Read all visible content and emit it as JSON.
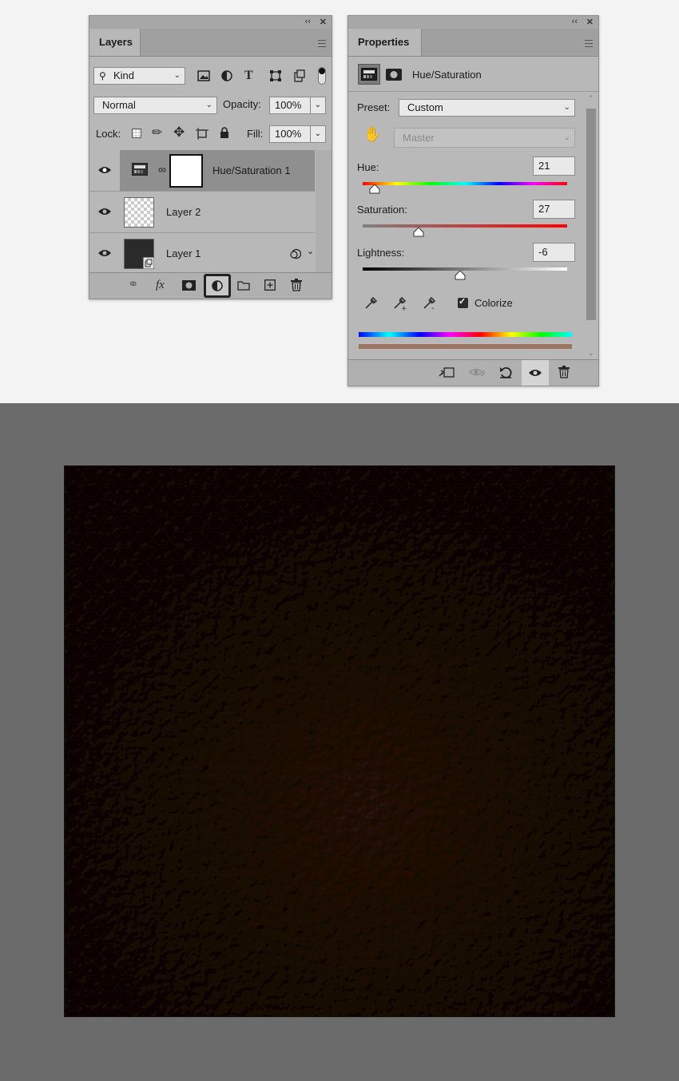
{
  "layers_panel": {
    "tab": "Layers",
    "filter_kind": "Kind",
    "blend_mode": "Normal",
    "opacity_label": "Opacity:",
    "opacity_value": "100%",
    "lock_label": "Lock:",
    "fill_label": "Fill:",
    "fill_value": "100%",
    "layers": [
      {
        "name": "Hue/Saturation 1",
        "type": "adjustment",
        "selected": true
      },
      {
        "name": "Layer 2",
        "type": "transparent"
      },
      {
        "name": "Layer 1",
        "type": "smart-object"
      }
    ],
    "icons": {
      "filter": [
        "image-filter-icon",
        "adjustment-filter-icon",
        "type-filter-icon",
        "shape-filter-icon",
        "smart-object-filter-icon",
        "filter-toggle-icon"
      ],
      "lock": [
        "lock-transparent-icon",
        "lock-pixels-icon",
        "lock-position-icon",
        "lock-artboard-icon",
        "lock-all-icon"
      ],
      "bottom": [
        "link-icon",
        "fx-icon",
        "mask-icon",
        "adjustment-layer-icon",
        "folder-icon",
        "new-layer-icon",
        "trash-icon"
      ]
    }
  },
  "properties_panel": {
    "tab": "Properties",
    "title": "Hue/Saturation",
    "preset_label": "Preset:",
    "preset_value": "Custom",
    "channel_value": "Master",
    "hue_label": "Hue:",
    "hue_value": "21",
    "saturation_label": "Saturation:",
    "saturation_value": "27",
    "lightness_label": "Lightness:",
    "lightness_value": "-6",
    "colorize_label": "Colorize",
    "colorize_checked": true,
    "slider_positions": {
      "hue": 0.06,
      "saturation": 0.27,
      "lightness": 0.47
    },
    "result_color": "#9b7462",
    "icons": {
      "header": [
        "adjustment-icon",
        "mask-icon"
      ],
      "eyedroppers": [
        "eyedropper-icon",
        "eyedropper-plus-icon",
        "eyedropper-minus-icon"
      ],
      "bottom": [
        "clip-to-layer-icon",
        "view-previous-icon",
        "reset-icon",
        "visibility-icon",
        "trash-icon"
      ]
    }
  },
  "canvas": {
    "background_color": "#6b6b6b",
    "texture": "leather",
    "texture_color": "#3b2a20"
  }
}
